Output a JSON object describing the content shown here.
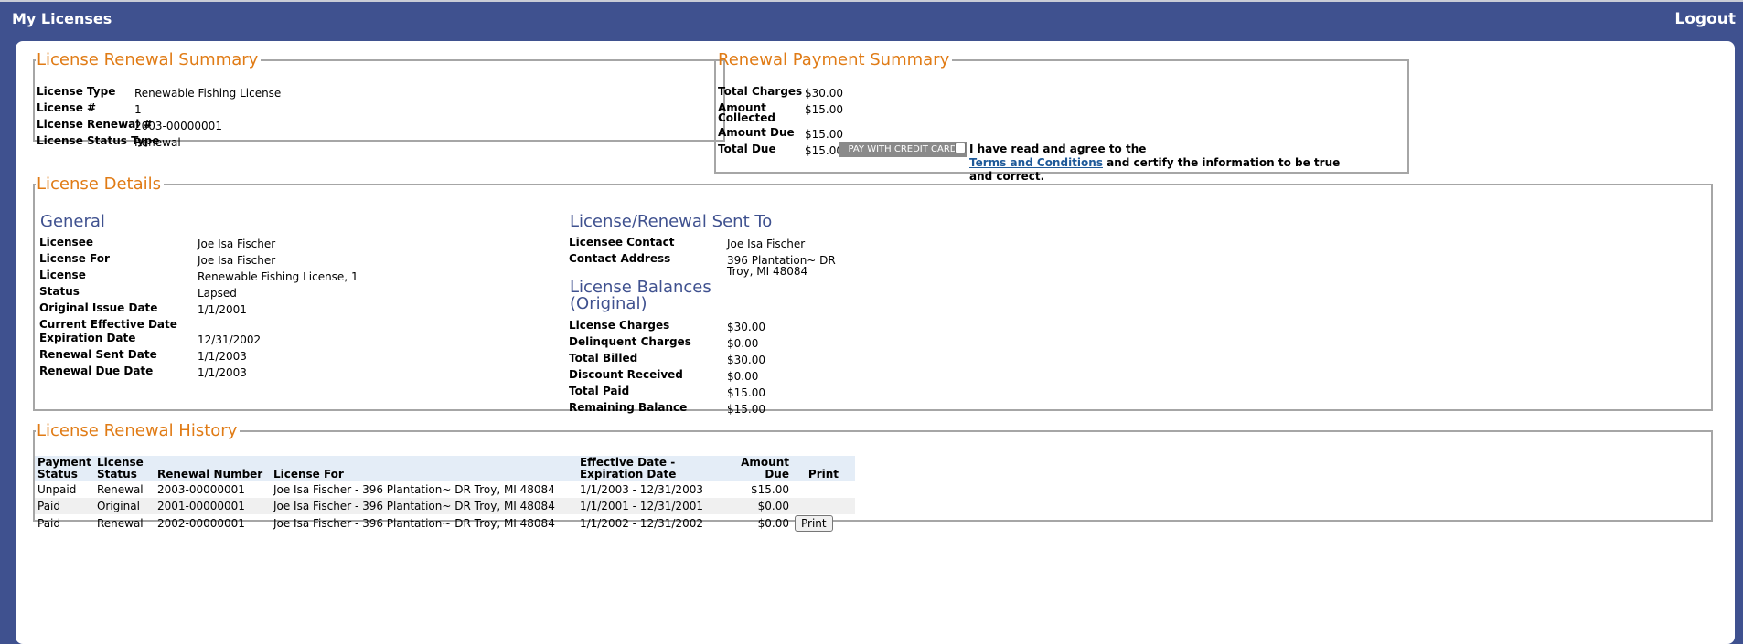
{
  "header": {
    "title": "My Licenses",
    "logout_label": "Logout"
  },
  "renewal_summary": {
    "legend": "License Renewal Summary",
    "rows": [
      {
        "label": "License Type",
        "value": "Renewable Fishing License"
      },
      {
        "label": "License #",
        "value": "1"
      },
      {
        "label": "License Renewal #",
        "value": "2003-00000001"
      },
      {
        "label": "License Status Type",
        "value": "Renewal"
      }
    ]
  },
  "payment_summary": {
    "legend": "Renewal Payment Summary",
    "total_charges_label": "Total Charges",
    "total_charges": "$30.00",
    "amount_collected_label_1": "Amount",
    "amount_collected_label_2": "Collected",
    "amount_collected": "$15.00",
    "amount_due_label": "Amount Due",
    "amount_due": "$15.00",
    "total_due_label": "Total Due",
    "total_due": "$15.00",
    "pay_button": "PAY WITH CREDIT CARD",
    "agree_text_1": "I have read and agree to the",
    "terms_link": "Terms and Conditions",
    "agree_text_2": " and certify the information to be true and correct."
  },
  "details": {
    "legend": "License Details",
    "general_heading": "General",
    "general": [
      {
        "label": "Licensee",
        "value": "Joe Isa Fischer"
      },
      {
        "label": "License For",
        "value": "Joe Isa Fischer"
      },
      {
        "label": "License",
        "value": "Renewable Fishing License, 1"
      },
      {
        "label": "Status",
        "value": "Lapsed"
      },
      {
        "label": "Original Issue Date",
        "value": "1/1/2001"
      },
      {
        "label": "Current Effective Date",
        "value": ""
      },
      {
        "label": "Expiration Date",
        "value": "12/31/2002"
      },
      {
        "label": "Renewal Sent Date",
        "value": "1/1/2003"
      },
      {
        "label": "Renewal Due Date",
        "value": "1/1/2003"
      }
    ],
    "sent_to_heading": "License/Renewal Sent To",
    "licensee_contact_label": "Licensee Contact",
    "licensee_contact": "Joe Isa Fischer",
    "contact_address_label": "Contact Address",
    "contact_address_1": "396 Plantation~ DR",
    "contact_address_2": "Troy, MI 48084",
    "balances_heading_1": "License Balances",
    "balances_heading_2": "(Original)",
    "balances": [
      {
        "label": "License Charges",
        "value": "$30.00"
      },
      {
        "label": "Delinquent Charges",
        "value": "$0.00"
      },
      {
        "label": "Total Billed",
        "value": "$30.00"
      },
      {
        "label": "Discount Received",
        "value": "$0.00"
      },
      {
        "label": "Total Paid",
        "value": "$15.00"
      },
      {
        "label": "Remaining Balance",
        "value": "$15.00"
      }
    ]
  },
  "history": {
    "legend": "License Renewal History",
    "headers": {
      "payment_status_1": "Payment",
      "payment_status_2": "Status",
      "license_status_1": "License",
      "license_status_2": "Status",
      "renewal_number": "Renewal Number",
      "license_for": "License For",
      "dates_1": "Effective Date -",
      "dates_2": "Expiration Date",
      "amount_1": "Amount",
      "amount_2": "Due",
      "print": "Print"
    },
    "rows": [
      {
        "payment_status": "Unpaid",
        "license_status": "Renewal",
        "renewal_number": "2003-00000001",
        "license_for": "Joe Isa Fischer - 396 Plantation~ DR Troy, MI 48084",
        "dates": "1/1/2003 - 12/31/2003",
        "amount": "$15.00",
        "print": ""
      },
      {
        "payment_status": "Paid",
        "license_status": "Original",
        "renewal_number": "2001-00000001",
        "license_for": "Joe Isa Fischer - 396 Plantation~ DR Troy, MI 48084",
        "dates": "1/1/2001 - 12/31/2001",
        "amount": "$0.00",
        "print": ""
      },
      {
        "payment_status": "Paid",
        "license_status": "Renewal",
        "renewal_number": "2002-00000001",
        "license_for": "Joe Isa Fischer - 396 Plantation~ DR Troy, MI 48084",
        "dates": "1/1/2002 - 12/31/2002",
        "amount": "$0.00",
        "print": "Print"
      }
    ]
  }
}
